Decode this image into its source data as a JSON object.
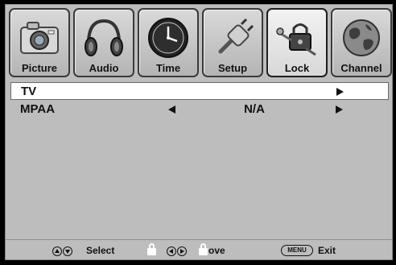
{
  "tabs": [
    {
      "label": "Picture",
      "icon": "camera-icon",
      "active": false
    },
    {
      "label": "Audio",
      "icon": "headphones-icon",
      "active": false
    },
    {
      "label": "Time",
      "icon": "clock-icon",
      "active": false
    },
    {
      "label": "Setup",
      "icon": "plug-icon",
      "active": false
    },
    {
      "label": "Lock",
      "icon": "lock-keys-icon",
      "active": true
    },
    {
      "label": "Channel",
      "icon": "globe-icon",
      "active": false
    }
  ],
  "menu": {
    "tv_label": "TV",
    "mpaa_label": "MPAA",
    "mpaa_value": "N/A"
  },
  "footer": {
    "select_label": "Select",
    "move_label": "ove",
    "menu_key": "MENU",
    "exit_label": "Exit"
  },
  "colors": {
    "panel": "#bdbdbd",
    "selected_row": "#ffffff",
    "text": "#111111"
  }
}
